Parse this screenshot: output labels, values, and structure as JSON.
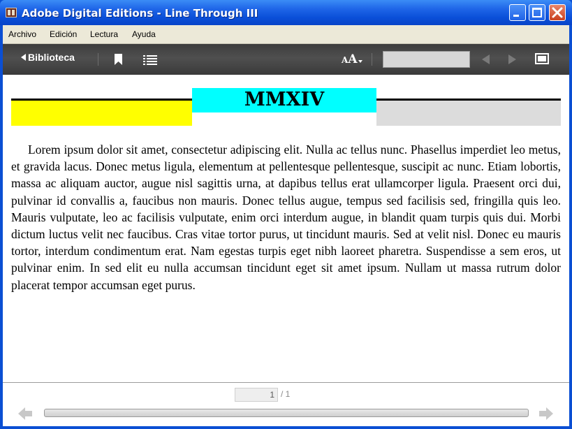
{
  "window": {
    "title": "Adobe Digital Editions - Line Through III"
  },
  "menu": {
    "items": [
      "Archivo",
      "Edición",
      "Lectura",
      "Ayuda"
    ]
  },
  "toolbar": {
    "library_label": "Biblioteca",
    "font_size_label_small": "A",
    "font_size_label_large": "A",
    "search_value": ""
  },
  "book": {
    "heading": "MMXIV",
    "paragraph": "Lorem ipsum dolor sit amet, consectetur adipiscing elit. Nulla ac tellus nunc. Phasellus imperdiet leo metus, et gravida lacus. Donec metus ligula, elementum at pellentesque pellentesque, suscipit ac nunc. Etiam lobortis, massa ac aliquam auctor, augue nisl sagittis urna, at dapibus tellus erat ullam­corper ligula. Praesent orci dui, pulvinar id convallis a, faucibus non mauris. Donec tellus augue, tempus sed facilisis sed, fringilla quis leo. Mauris vulputate, leo ac facilisis vulputate, enim orci in­terdum augue, in blandit quam turpis quis dui. Morbi dictum luctus velit nec faucibus. Cras vitae tortor purus, ut tincidunt mauris. Sed at velit nisl. Donec eu mauris tortor, interdum condimentum erat. Nam egestas turpis eget nibh laoreet pharetra. Suspendisse a sem eros, ut pulvinar enim. In sed elit eu nulla accumsan tincidunt eget sit amet ipsum. Nullam ut massa rutrum dolor placerat tem­por accumsan eget purus.",
    "colors": {
      "left_band": "#ffff00",
      "heading_band": "#00ffff",
      "right_band": "#dcdcdc"
    }
  },
  "pagination": {
    "current_page": "1",
    "total_pages": "/ 1"
  }
}
